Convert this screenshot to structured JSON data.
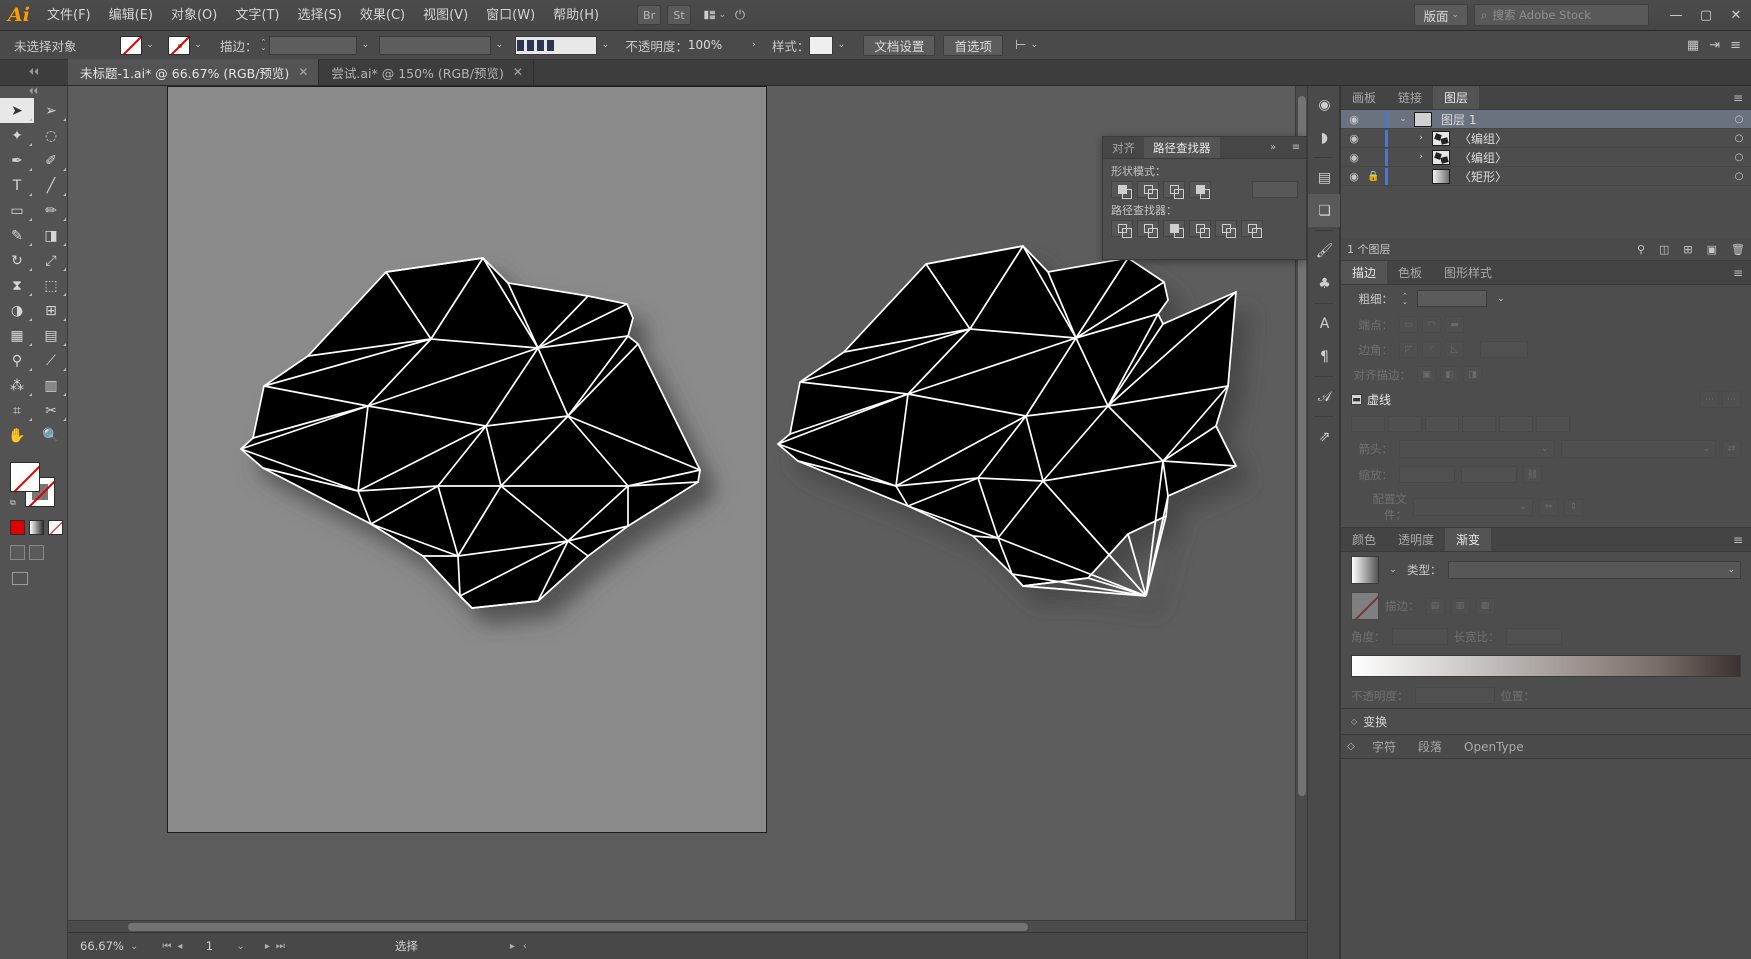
{
  "app": {
    "logo": "Ai"
  },
  "menubar": {
    "items": [
      {
        "label": "文件(F)"
      },
      {
        "label": "编辑(E)"
      },
      {
        "label": "对象(O)"
      },
      {
        "label": "文字(T)"
      },
      {
        "label": "选择(S)"
      },
      {
        "label": "效果(C)"
      },
      {
        "label": "视图(V)"
      },
      {
        "label": "窗口(W)"
      },
      {
        "label": "帮助(H)"
      }
    ],
    "bridge_label": "Br",
    "stock_label": "St",
    "arrange_icon": "arrange-documents-icon",
    "workspace": "版面",
    "search_placeholder": "搜索 Adobe Stock",
    "window": {
      "minimize": "—",
      "maximize": "▢",
      "close": "✕"
    }
  },
  "controlbar": {
    "selection_status": "未选择对象",
    "fill_label": "fill-swatch",
    "stroke_label": "stroke-swatch",
    "stroke_text": "描边：",
    "stroke_weight": "",
    "brush_def": "",
    "opacity_label": "不透明度：",
    "opacity_value": "100%",
    "style_label": "样式：",
    "doc_setup": "文档设置",
    "preferences": "首选项",
    "align_icon": "align-icon"
  },
  "tabs": [
    {
      "title": "未标题-1.ai* @ 66.67% (RGB/预览)",
      "active": true,
      "close": "✕"
    },
    {
      "title": "尝试.ai* @ 150% (RGB/预览)",
      "active": false,
      "close": "✕"
    }
  ],
  "toolbar": {
    "tools": [
      {
        "name": "selection-tool",
        "glyph": "➤"
      },
      {
        "name": "direct-selection-tool",
        "glyph": "➢"
      },
      {
        "name": "magic-wand-tool",
        "glyph": "✦"
      },
      {
        "name": "lasso-tool",
        "glyph": "◌"
      },
      {
        "name": "pen-tool",
        "glyph": "✒"
      },
      {
        "name": "curvature-tool",
        "glyph": "✐"
      },
      {
        "name": "type-tool",
        "glyph": "T"
      },
      {
        "name": "line-segment-tool",
        "glyph": "╱"
      },
      {
        "name": "rectangle-tool",
        "glyph": "▢"
      },
      {
        "name": "paintbrush-tool",
        "glyph": "🖌"
      },
      {
        "name": "shaper-tool",
        "glyph": "✎"
      },
      {
        "name": "eraser-tool",
        "glyph": "◧"
      },
      {
        "name": "rotate-tool",
        "glyph": "↻"
      },
      {
        "name": "scale-tool",
        "glyph": "⤢"
      },
      {
        "name": "width-tool",
        "glyph": "⧖"
      },
      {
        "name": "free-transform-tool",
        "glyph": "⬚"
      },
      {
        "name": "shape-builder-tool",
        "glyph": "◑"
      },
      {
        "name": "perspective-grid-tool",
        "glyph": "⊞"
      },
      {
        "name": "mesh-tool",
        "glyph": "▦"
      },
      {
        "name": "gradient-tool",
        "glyph": "▥"
      },
      {
        "name": "eyedropper-tool",
        "glyph": "⚲"
      },
      {
        "name": "blend-tool",
        "glyph": "⟋"
      },
      {
        "name": "symbol-sprayer-tool",
        "glyph": "⁂"
      },
      {
        "name": "column-graph-tool",
        "glyph": "▥"
      },
      {
        "name": "artboard-tool",
        "glyph": "⌗"
      },
      {
        "name": "slice-tool",
        "glyph": "✂"
      },
      {
        "name": "hand-tool",
        "glyph": "✋"
      },
      {
        "name": "zoom-tool",
        "glyph": "🔍"
      }
    ],
    "fill_stroke": {
      "fill": "none-swatch",
      "stroke": "gray-swatch",
      "mini": "default-colors"
    },
    "color_modes": [
      {
        "name": "color-swatch"
      },
      {
        "name": "gradient-swatch"
      },
      {
        "name": "none-swatch"
      }
    ],
    "draw_modes": [
      {
        "name": "draw-normal"
      },
      {
        "name": "draw-behind"
      }
    ],
    "screen_modes": [
      {
        "name": "screen-mode-normal"
      },
      {
        "name": "screen-mode-full"
      }
    ]
  },
  "pathfinder": {
    "tabs": [
      {
        "label": "对齐",
        "active": false
      },
      {
        "label": "路径查找器",
        "active": true
      }
    ],
    "collapse": "»",
    "menu": "≡",
    "shape_modes_label": "形状模式：",
    "shape_modes": [
      {
        "name": "unite"
      },
      {
        "name": "minus-front"
      },
      {
        "name": "intersect"
      },
      {
        "name": "exclude"
      }
    ],
    "expand_label": "",
    "pathfinders_label": "路径查找器：",
    "pathfinders": [
      {
        "name": "divide"
      },
      {
        "name": "trim"
      },
      {
        "name": "merge"
      },
      {
        "name": "crop"
      },
      {
        "name": "outline"
      },
      {
        "name": "minus-back"
      }
    ]
  },
  "dock_icons": [
    {
      "name": "color-guide-icon",
      "glyph": "◉"
    },
    {
      "name": "swatches-icon",
      "glyph": "◗"
    },
    {
      "name": "align-panel-icon",
      "glyph": "▤"
    },
    {
      "name": "pathfinder-panel-icon",
      "glyph": "❏"
    },
    {
      "name": "brushes-icon",
      "glyph": "🖌"
    },
    {
      "name": "symbols-icon",
      "glyph": "♣"
    },
    {
      "name": "character-styles-icon",
      "glyph": "A"
    },
    {
      "name": "paragraph-styles-icon",
      "glyph": "¶"
    },
    {
      "name": "glyphs-icon",
      "glyph": "𝒜"
    },
    {
      "name": "asset-export-icon",
      "glyph": "⇗"
    }
  ],
  "layers_panel": {
    "tabs": [
      {
        "label": "画板",
        "active": false
      },
      {
        "label": "链接",
        "active": false
      },
      {
        "label": "图层",
        "active": true
      }
    ],
    "menu": "≡",
    "rows": [
      {
        "name": "图层 1",
        "eye": "◉",
        "lock": "",
        "arrow": "⌄",
        "thumb": "layer-thumb",
        "target": "○",
        "selected": true
      },
      {
        "name": "〈编组〉",
        "eye": "◉",
        "lock": "",
        "arrow": "›",
        "thumb": "art-thumb",
        "target": "○",
        "selected": false
      },
      {
        "name": "〈编组〉",
        "eye": "◉",
        "lock": "",
        "arrow": "›",
        "thumb": "art-thumb",
        "target": "○",
        "selected": false
      },
      {
        "name": "〈矩形〉",
        "eye": "◉",
        "lock": "🔒",
        "arrow": "",
        "thumb": "gradient-thumb",
        "target": "○",
        "selected": false
      }
    ],
    "footer_count": "1 个图层",
    "footer_icons": [
      {
        "name": "locate-object-icon",
        "glyph": "⚲"
      },
      {
        "name": "make-mask-icon",
        "glyph": "◫"
      },
      {
        "name": "new-sublayer-icon",
        "glyph": "⊞"
      },
      {
        "name": "new-layer-icon",
        "glyph": "▣"
      },
      {
        "name": "delete-layer-icon",
        "glyph": "🗑"
      }
    ]
  },
  "stroke_panel": {
    "tabs": [
      {
        "label": "描边",
        "active": true
      },
      {
        "label": "色板",
        "active": false
      },
      {
        "label": "图形样式",
        "active": false
      }
    ],
    "menu": "≡",
    "weight_label": "粗细：",
    "weight_value": "",
    "cap_label": "端点：",
    "corner_label": "边角：",
    "align_label": "对齐描边：",
    "dash_label": "虚线",
    "arrow_label": "箭头：",
    "scale_label": "缩放：",
    "profile_label": "配置文件："
  },
  "gradient_panel": {
    "tabs": [
      {
        "label": "颜色",
        "active": false
      },
      {
        "label": "透明度",
        "active": false
      },
      {
        "label": "渐变",
        "active": true
      }
    ],
    "menu": "≡",
    "type_label": "类型：",
    "stroke_label": "描边：",
    "angle_label": "角度：",
    "aspect_label": "长宽比：",
    "opacity_label": "不透明度：",
    "location_label": "位置："
  },
  "bottom_panels": [
    {
      "label": "变换",
      "name": "transform-panel"
    }
  ],
  "bottom_tabs": [
    {
      "label": "字符",
      "active": false
    },
    {
      "label": "段落",
      "active": false
    },
    {
      "label": "OpenType",
      "active": false
    }
  ],
  "statusbar": {
    "zoom": "66.67%",
    "zoom_chevron": "⌄",
    "first": "⏮",
    "prev": "◂",
    "page": "1",
    "page_chevron": "⌄",
    "next": "▸",
    "last": "⏭",
    "status_text": "选择",
    "nav_next": "▸",
    "nav_prev": "‹"
  },
  "colors": {
    "chrome": "#535353",
    "menubar": "#4c4c4c",
    "panel": "#4d4d4d",
    "canvas": "#5d5d5d",
    "artboard": "#8b8b8b",
    "accent_orange": "#ff9a00",
    "selection_blue": "#6a7280",
    "layer_bar_blue": "#4a78c8",
    "none_red": "#e00000",
    "artwork_fill": "#000000",
    "artwork_stroke": "#ffffff"
  },
  "artwork": {
    "description": "两个黑色低多边形三角网格图形，白色描边，带阴影",
    "left_shape_name": "polygon-mesh-left",
    "right_shape_name": "polygon-mesh-right"
  }
}
